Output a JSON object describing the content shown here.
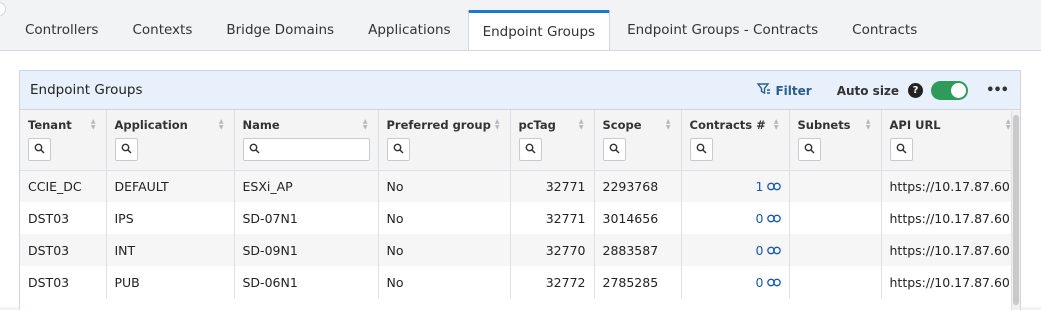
{
  "tabs": [
    {
      "label": "Controllers"
    },
    {
      "label": "Contexts"
    },
    {
      "label": "Bridge Domains"
    },
    {
      "label": "Applications"
    },
    {
      "label": "Endpoint Groups",
      "active": true
    },
    {
      "label": "Endpoint Groups - Contracts"
    },
    {
      "label": "Contracts"
    }
  ],
  "card": {
    "title": "Endpoint Groups",
    "filter_label": "Filter",
    "autosize_label": "Auto size",
    "help": "?",
    "autosize_on": true
  },
  "columns": [
    "Tenant",
    "Application",
    "Name",
    "Preferred group",
    "pcTag",
    "Scope",
    "Contracts #",
    "Subnets",
    "API URL"
  ],
  "rows": [
    {
      "tenant": "CCIE_DC",
      "application": "DEFAULT",
      "name": "ESXi_AP",
      "preferred": "No",
      "pctag": "32771",
      "scope": "2293768",
      "contracts": "1",
      "subnets": "",
      "api": "https://10.17.87.60"
    },
    {
      "tenant": "DST03",
      "application": "IPS",
      "name": "SD-07N1",
      "preferred": "No",
      "pctag": "32771",
      "scope": "3014656",
      "contracts": "0",
      "subnets": "",
      "api": "https://10.17.87.60"
    },
    {
      "tenant": "DST03",
      "application": "INT",
      "name": "SD-09N1",
      "preferred": "No",
      "pctag": "32770",
      "scope": "2883587",
      "contracts": "0",
      "subnets": "",
      "api": "https://10.17.87.60"
    },
    {
      "tenant": "DST03",
      "application": "PUB",
      "name": "SD-06N1",
      "preferred": "No",
      "pctag": "32772",
      "scope": "2785285",
      "contracts": "0",
      "subnets": "",
      "api": "https://10.17.87.60"
    }
  ],
  "colors": {
    "accent": "#1c78c9",
    "toggle_on": "#2e9b5a",
    "link": "#1c5aa6"
  },
  "icons": {
    "filter": "filter-icon",
    "search": "search-icon",
    "link": "link-icon",
    "more": "more-icon",
    "help": "help-icon"
  }
}
